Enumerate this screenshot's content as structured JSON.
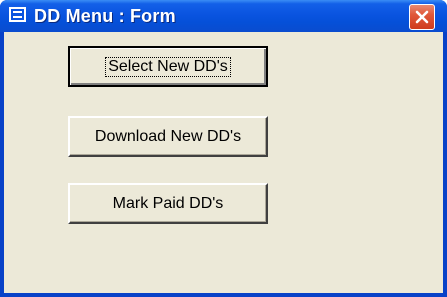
{
  "window": {
    "title": "DD Menu : Form",
    "icon": "form-icon",
    "close_icon": "close-icon",
    "titlebar_color": "#0a54e0",
    "close_color": "#e0583a"
  },
  "form": {
    "background": "#ece9d8",
    "buttons": [
      {
        "label": "Select New DD's",
        "default": true
      },
      {
        "label": "Download New DD's",
        "default": false
      },
      {
        "label": "Mark Paid DD's",
        "default": false
      }
    ]
  }
}
